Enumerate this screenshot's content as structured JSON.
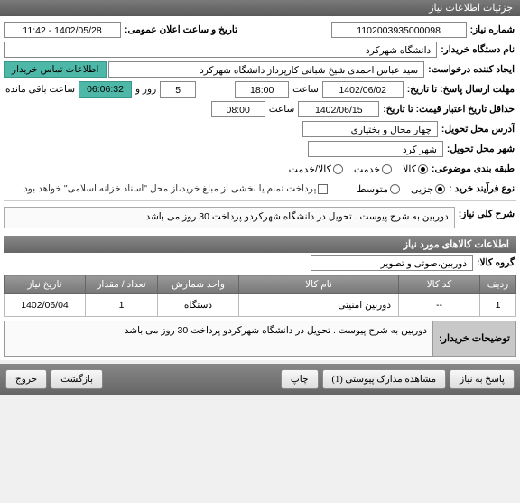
{
  "titlebar": "جزئیات اطلاعات نیاز",
  "labels": {
    "need_number": "شماره نیاز:",
    "public_datetime": "تاریخ و ساعت اعلان عمومی:",
    "buyer_name": "نام دستگاه خریدار:",
    "requester": "ایجاد کننده درخواست:",
    "contact_info": "اطلاعات تماس خریدار",
    "deadline": "مهلت ارسال پاسخ: تا تاریخ:",
    "saat": "ساعت",
    "rooz_va": "روز و",
    "remaining": "ساعت باقی مانده",
    "min_credit": "حداقل تاریخ اعتبار قیمت: تا تاریخ:",
    "delivery_address": "آدرس محل تحویل:",
    "delivery_city": "شهر محل تحویل:",
    "category": "طبقه بندی موضوعی:",
    "purchase_type": "نوع فرآیند خرید :",
    "partial_payment": "پرداخت تمام یا بخشی از مبلغ خرید،از محل \"اسناد خزانه اسلامی\" خواهد بود.",
    "need_desc": "شرح کلی نیاز:",
    "goods_info": "اطلاعات کالاهای مورد نیاز",
    "goods_group": "گروه کالا:",
    "buyer_notes": "توضیحات خریدار:"
  },
  "values": {
    "need_number": "1102003935000098",
    "public_datetime": "1402/05/28 - 11:42",
    "buyer_name": "دانشگاه شهرکرد",
    "requester": "سید عباس احمدی شیخ شبانی کارپرداز دانشگاه شهرکرد",
    "deadline_date": "1402/06/02",
    "deadline_time": "18:00",
    "days_remaining": "5",
    "time_remaining": "06:06:32",
    "credit_date": "1402/06/15",
    "credit_time": "08:00",
    "delivery_address": "چهار محال و بختیاری",
    "delivery_city": "شهر کرد",
    "need_desc_text": "دوربین به شرح پیوست . تحویل در دانشگاه شهرکردو پرداخت 30 روز می باشد",
    "goods_group": "دوربین،صوتی و تصویر",
    "buyer_notes_text": "دوربین به شرح پیوست . تحویل در دانشگاه شهرکردو پرداخت 30 روز می باشد"
  },
  "radios": {
    "category": {
      "options": [
        "کالا",
        "خدمت",
        "کالا/خدمت"
      ],
      "selected": 0
    },
    "purchase": {
      "options": [
        "جزیی",
        "متوسط"
      ],
      "selected": 0
    }
  },
  "table": {
    "headers": [
      "ردیف",
      "کد کالا",
      "نام کالا",
      "واحد شمارش",
      "تعداد / مقدار",
      "تاریخ نیاز"
    ],
    "rows": [
      {
        "c0": "1",
        "c1": "--",
        "c2": "دوربین امنیتی",
        "c3": "دستگاه",
        "c4": "1",
        "c5": "1402/06/04"
      }
    ]
  },
  "footer": {
    "respond": "پاسخ به نیاز",
    "attachments": "مشاهده مدارک پیوستی (1)",
    "print": "چاپ",
    "back": "بازگشت",
    "exit": "خروج"
  }
}
